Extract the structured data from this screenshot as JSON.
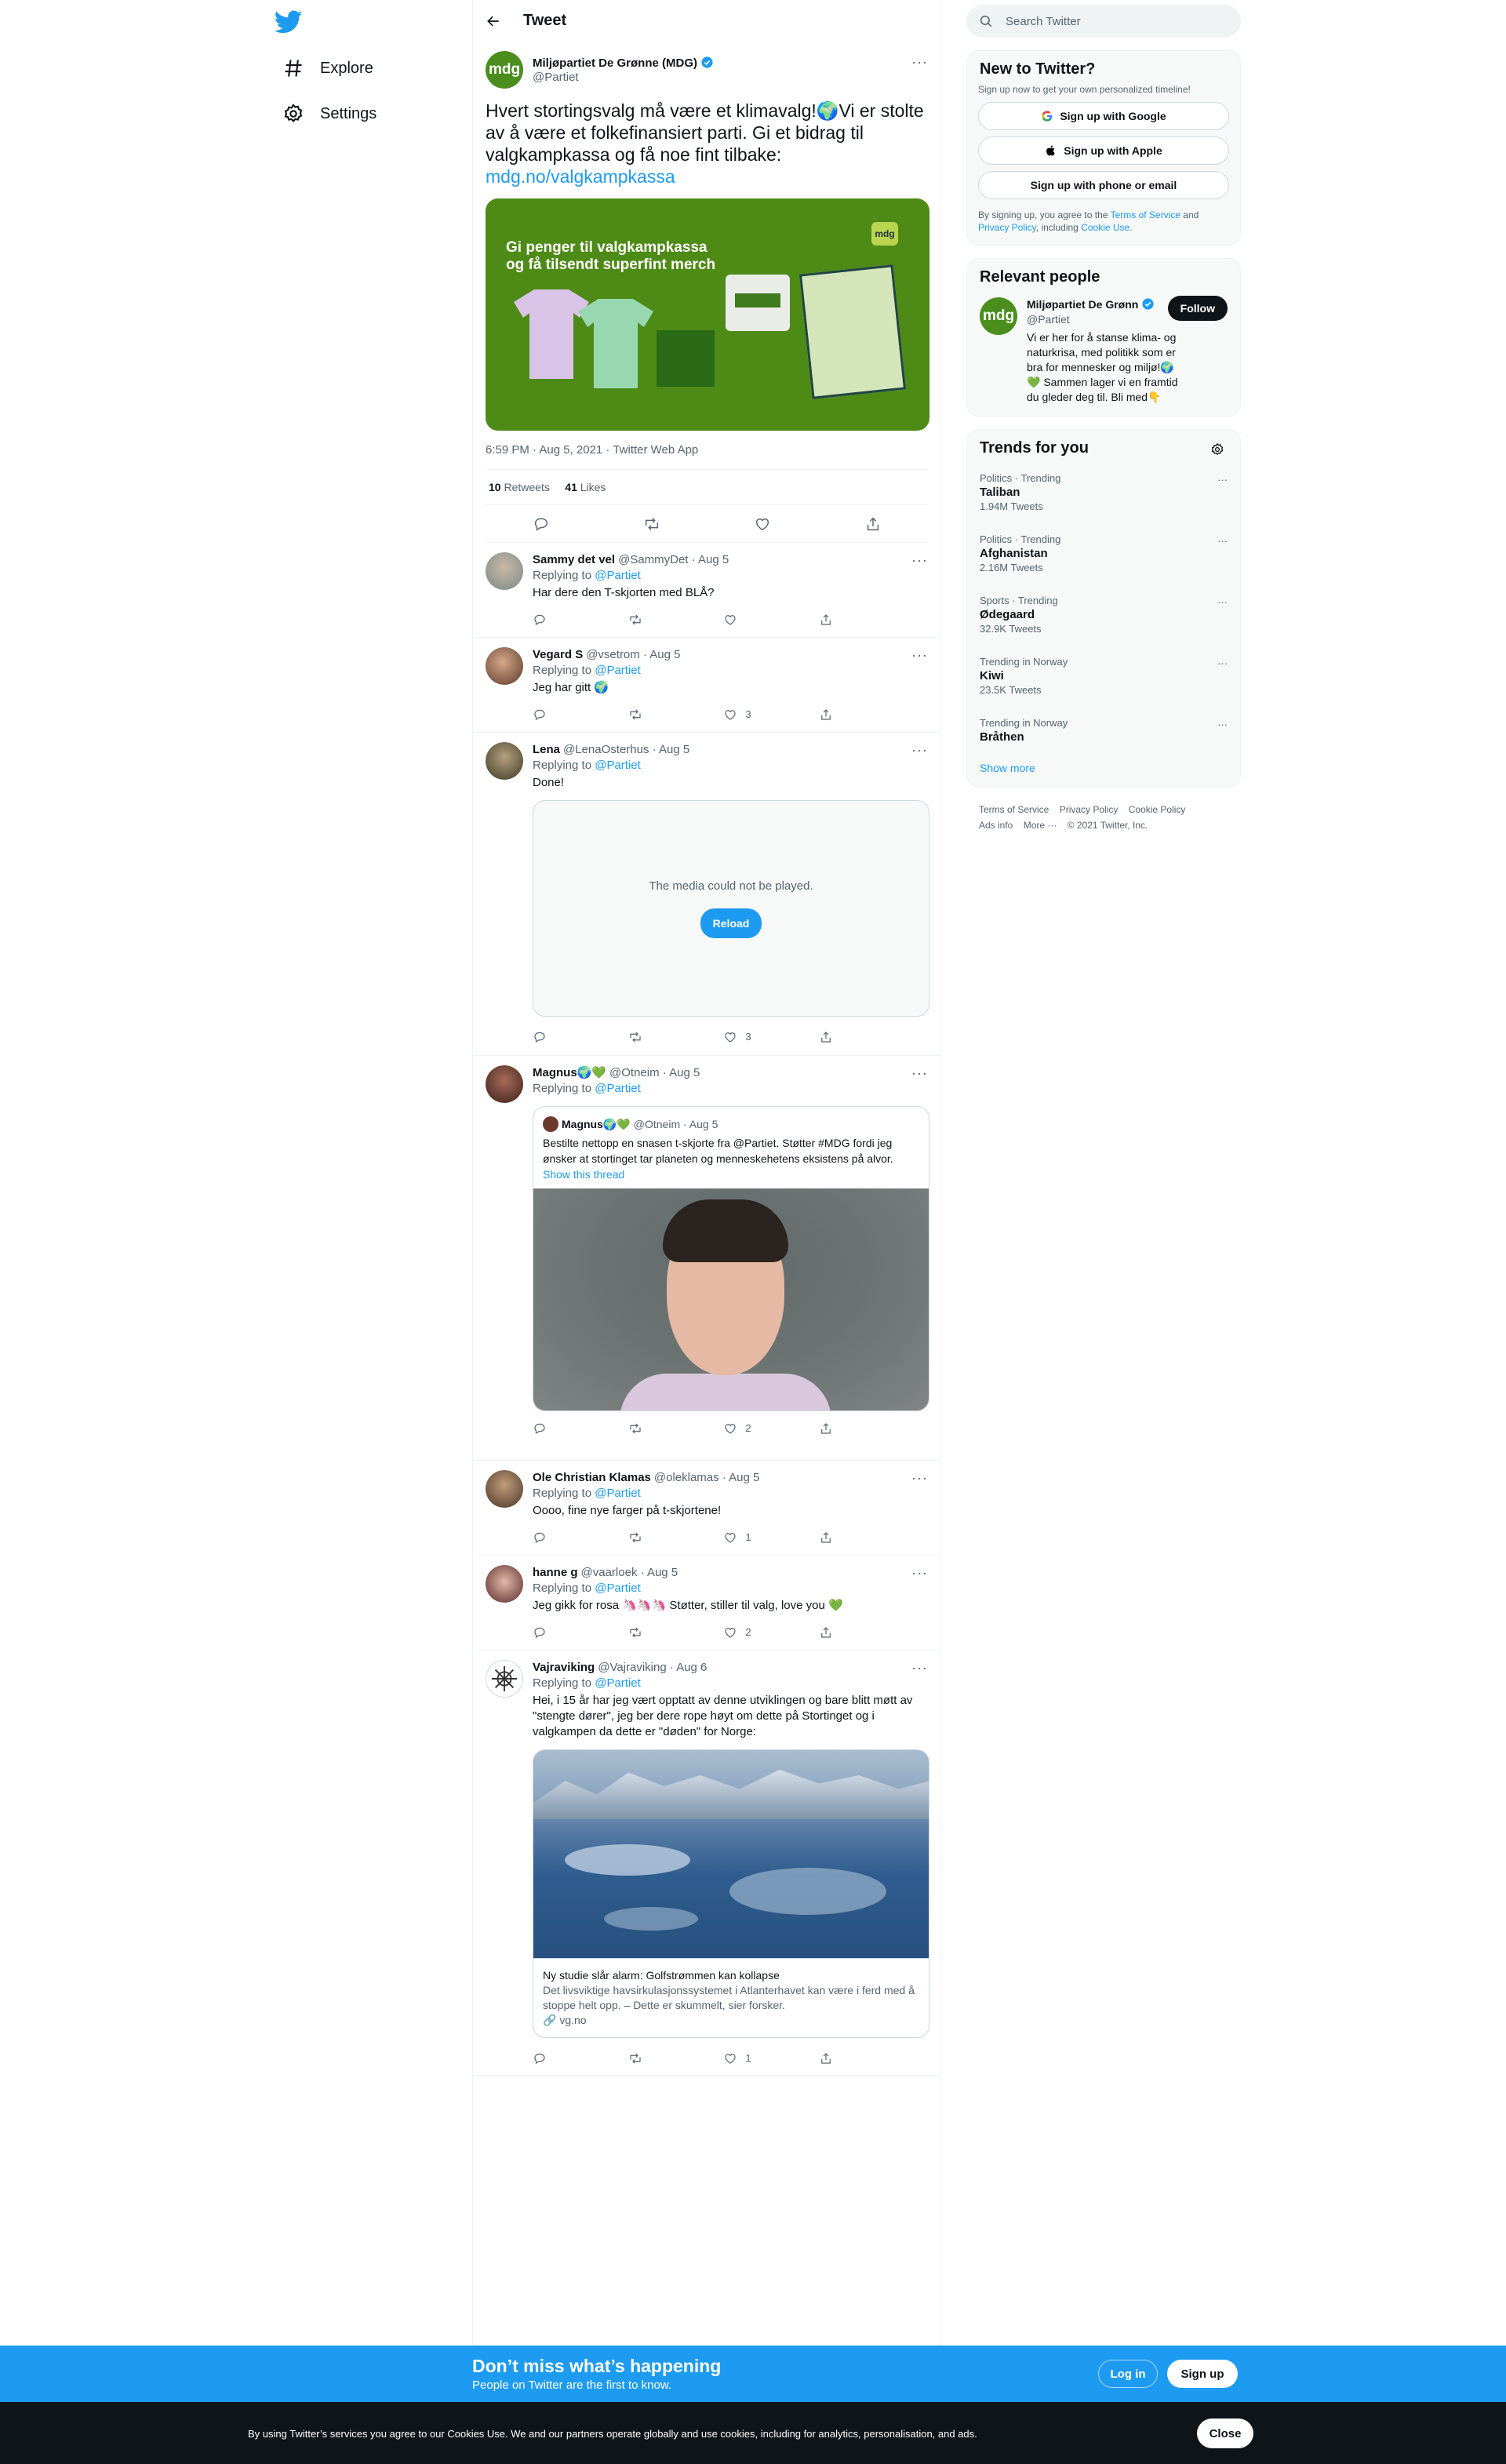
{
  "nav": {
    "explore": "Explore",
    "settings": "Settings"
  },
  "header": {
    "title": "Tweet"
  },
  "main_tweet": {
    "name": "Miljøpartiet De Grønne (MDG)",
    "handle": "@Partiet",
    "avatar_text": "mdg",
    "text": "Hvert stortingsvalg må være et klimavalg!🌍Vi er stolte av å være et folkefinansiert parti. Gi et bidrag til valgkampkassa og få noe fint tilbake:",
    "link": "mdg.no/valgkampkassa",
    "promo_line1": "Gi penger til valgkampkassa",
    "promo_line2": "og få tilsendt superfint merch",
    "promo_tag": "mdg",
    "meta": "6:59 PM · Aug 5, 2021 · Twitter Web App",
    "retweets": "10",
    "retweets_label": "Retweets",
    "likes": "41",
    "likes_label": "Likes"
  },
  "replies": [
    {
      "name": "Sammy det vel",
      "handle": "@SammyDet · Aug 5",
      "replying": "Replying to",
      "to": "@Partiet",
      "text": "Har dere den T-skjorten med BLÅ?",
      "likes": ""
    },
    {
      "name": "Vegard S",
      "handle": "@vsetrom · Aug 5",
      "replying": "Replying to",
      "to": "@Partiet",
      "text": "Jeg har gitt 🌍",
      "likes": "3"
    },
    {
      "name": "Lena",
      "handle": "@LenaOsterhus · Aug 5",
      "replying": "Replying to",
      "to": "@Partiet",
      "text": "Done!",
      "likes": "3",
      "media_error": "The media could not be played.",
      "reload": "Reload"
    },
    {
      "name": "Magnus🌍💚",
      "handle": "@Otneim · Aug 5",
      "replying": "Replying to",
      "to": "@Partiet",
      "text": "",
      "likes": "2",
      "quote": {
        "name": "Magnus🌍💚",
        "handle": "@Otneim · Aug 5",
        "text": "Bestilte nettopp en snasen t-skjorte fra @Partiet. Støtter #MDG fordi jeg ønsker at stortinget tar planeten og menneskehetens eksistens på alvor.",
        "show": "Show this thread"
      }
    },
    {
      "name": "Ole Christian Klamas",
      "handle": "@oleklamas · Aug 5",
      "replying": "Replying to",
      "to": "@Partiet",
      "text": "Oooo, fine nye farger på t-skjortene!",
      "likes": "1"
    },
    {
      "name": "hanne g",
      "handle": "@vaarloek · Aug 5",
      "replying": "Replying to",
      "to": "@Partiet",
      "text": "Jeg gikk for rosa 🦄🦄🦄 Støtter, stiller til valg, love you 💚",
      "likes": "2"
    },
    {
      "name": "Vajraviking",
      "handle": "@Vajraviking · Aug 6",
      "replying": "Replying to",
      "to": "@Partiet",
      "text": "Hei, i 15 år har jeg vært opptatt av denne utviklingen og bare blitt møtt av \"stengte dører\", jeg ber dere rope høyt om dette på Stortinget og i valgkampen da dette er \"døden\" for Norge:",
      "likes": "1",
      "card": {
        "title": "Ny studie slår alarm: Golfstrømmen kan kollapse",
        "desc": "Det livsviktige havsirkulasjonssystemet i Atlanterhavet kan være i ferd med å stoppe helt opp. – Dette er skummelt, sier forsker.",
        "domain": "🔗 vg.no"
      }
    }
  ],
  "sidebar": {
    "search_placeholder": "Search Twitter",
    "new_title": "New to Twitter?",
    "new_sub": "Sign up now to get your own personalized timeline!",
    "google": "Sign up with Google",
    "apple": "Sign up with Apple",
    "phone": "Sign up with phone or email",
    "terms_pre": "By signing up, you agree to the",
    "terms": "Terms of Service",
    "and": "and",
    "privacy": "Privacy Policy",
    "including": ", including",
    "cookie": "Cookie Use.",
    "relevant_title": "Relevant people",
    "rp_name": "Miljøpartiet De Grønn",
    "rp_handle": "@Partiet",
    "rp_follow": "Follow",
    "rp_bio": "Vi er her for å stanse klima- og naturkrisa, med politikk som er bra for mennesker og miljø!🌍💚 Sammen lager vi en framtid du gleder deg til. Bli med👇",
    "trends_title": "Trends for you",
    "trends": [
      {
        "cat": "Politics · Trending",
        "name": "Taliban",
        "count": "1.94M Tweets"
      },
      {
        "cat": "Politics · Trending",
        "name": "Afghanistan",
        "count": "2.16M Tweets"
      },
      {
        "cat": "Sports · Trending",
        "name": "Ødegaard",
        "count": "32.9K Tweets"
      },
      {
        "cat": "Trending in Norway",
        "name": "Kiwi",
        "count": "23.5K Tweets"
      },
      {
        "cat": "Trending in Norway",
        "name": "Bråthen",
        "count": ""
      }
    ],
    "show_more": "Show more",
    "footer": {
      "tos": "Terms of Service",
      "privacy": "Privacy Policy",
      "cookie": "Cookie Policy",
      "ads": "Ads info",
      "more": "More ···",
      "copy": "© 2021 Twitter, Inc."
    }
  },
  "signup_bar": {
    "title": "Don’t miss what’s happening",
    "sub": "People on Twitter are the first to know.",
    "login": "Log in",
    "signup": "Sign up"
  },
  "cookie_bar": {
    "text": "By using Twitter’s services you agree to our Cookies Use. We and our partners operate globally and use cookies, including for analytics, personalisation, and ads.",
    "close": "Close"
  },
  "colors": {
    "accent": "#1d9bf0",
    "mdg_green": "#4b8e1e",
    "text": "#0f1419",
    "muted": "#536471"
  }
}
